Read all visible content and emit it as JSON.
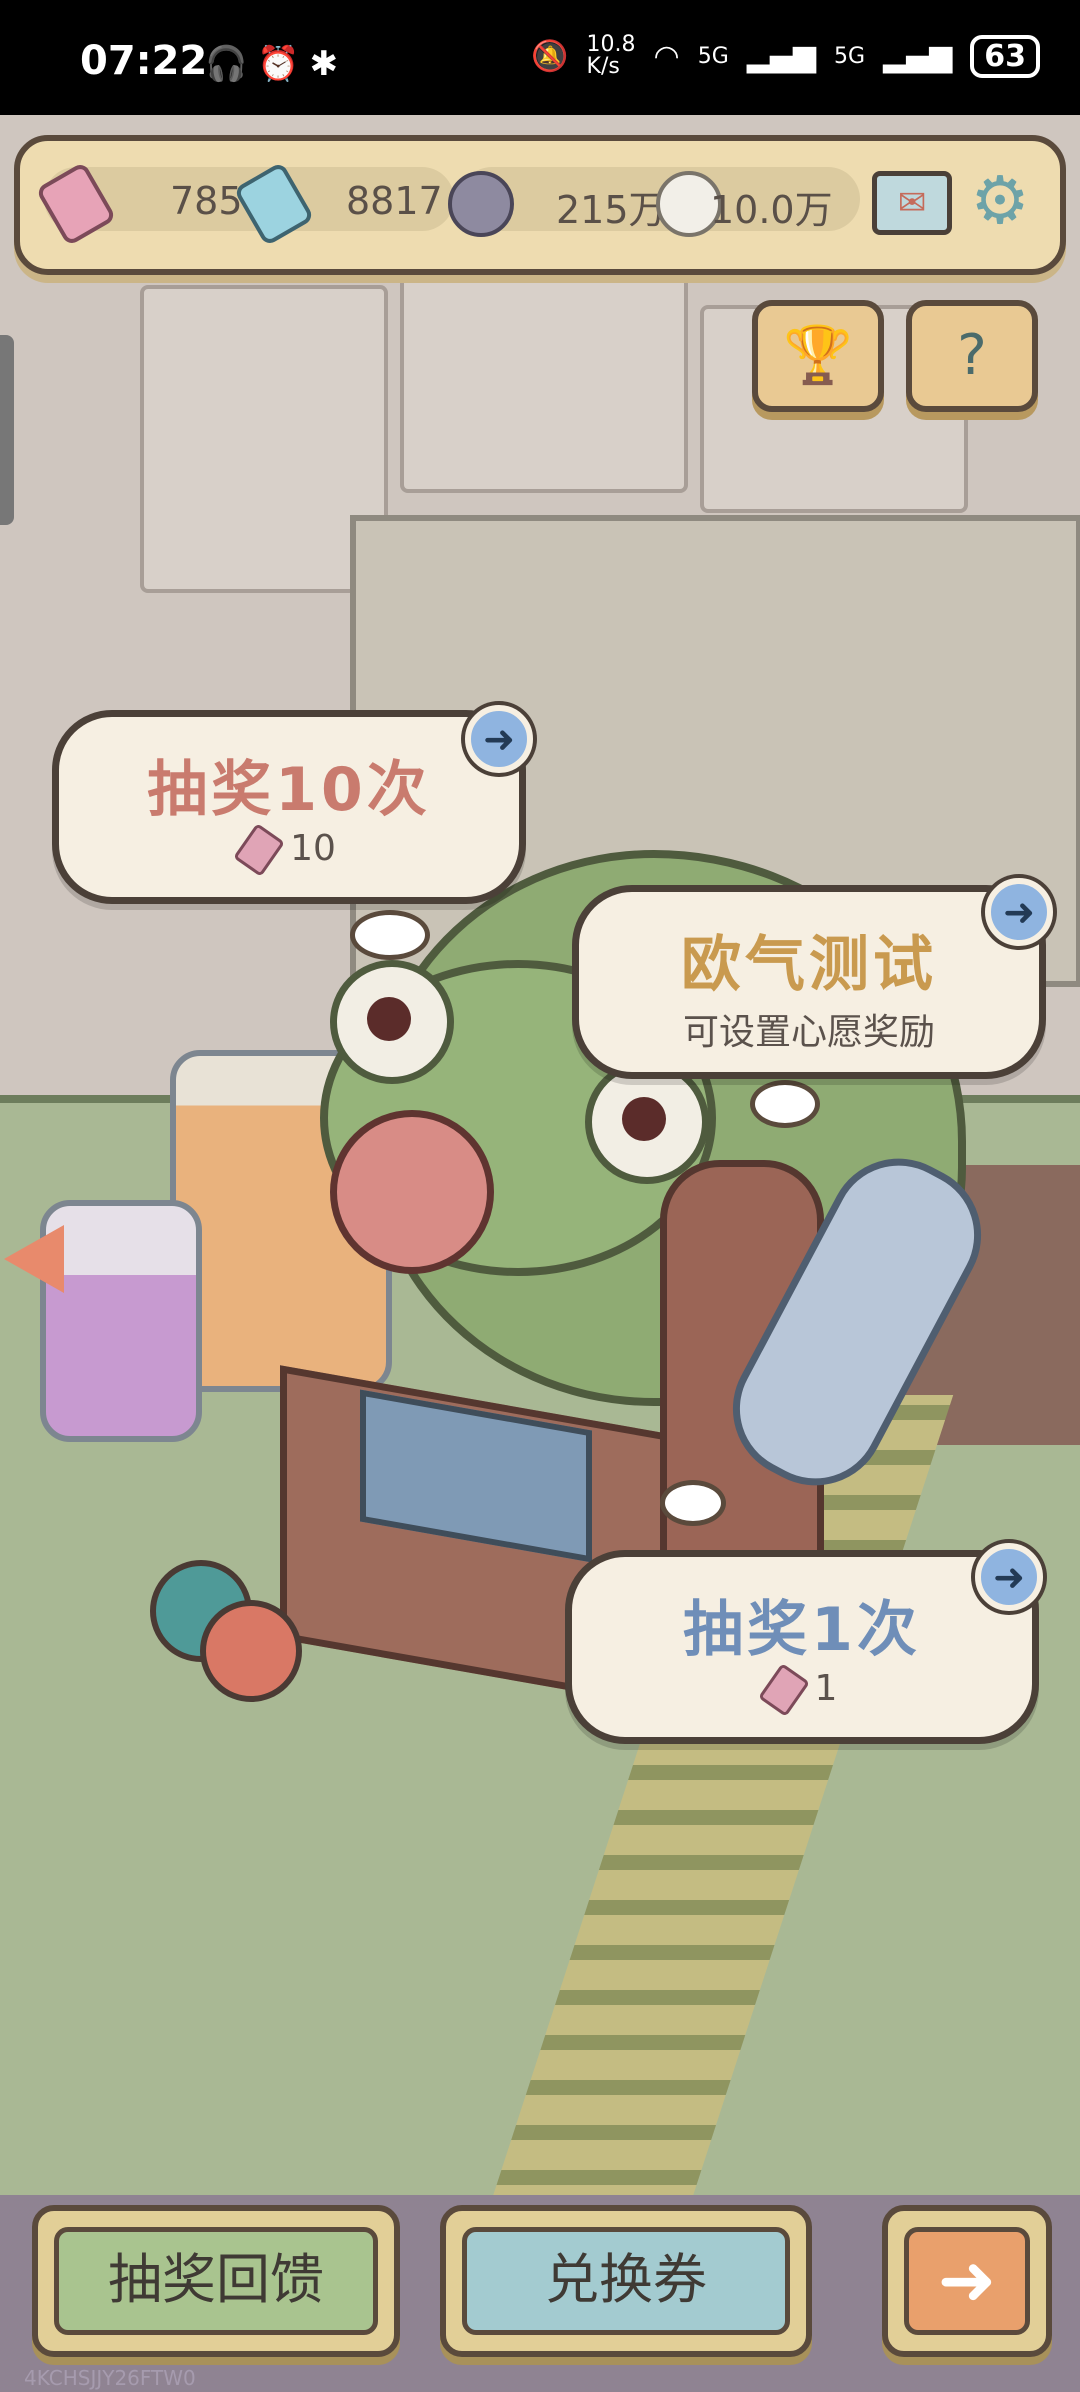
{
  "status_bar": {
    "time": "07:22",
    "left_icons": "🎧⏰✱",
    "net_speed": "10.8\nK/s",
    "signal1": "5G",
    "signal2": "5G",
    "battery": "63"
  },
  "currency_bar": {
    "ticket_pink": "785",
    "ticket_blue": "8817",
    "dark_drop": "215万",
    "white_drop": "10.0万"
  },
  "bubbles": {
    "draw10": {
      "title": "抽奖10次",
      "cost": "10"
    },
    "luck_test": {
      "title": "欧气测试",
      "subtitle": "可设置心愿奖励"
    },
    "draw1": {
      "title": "抽奖1次",
      "cost": "1"
    }
  },
  "bottom": {
    "feedback_label": "抽奖回馈",
    "coupon_label": "兑换券"
  },
  "watermark": "4KCHSJJY26FTW0",
  "colors": {
    "draw10_title": "#c97b6e",
    "luck_title": "#c99a4f",
    "draw1_title": "#6f8eb8",
    "coupon_btn": "#a3cbd0",
    "feedback_btn": "#a9c48f",
    "next_btn": "#e9a06c"
  }
}
